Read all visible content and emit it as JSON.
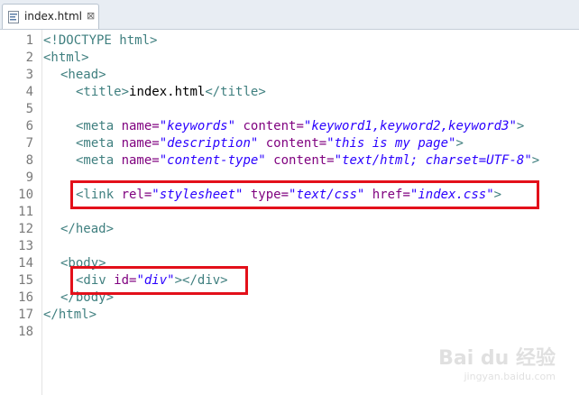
{
  "tab": {
    "title": "index.html",
    "close_glyph": "⊠",
    "icon": "html-file-icon"
  },
  "line_numbers": [
    "1",
    "2",
    "3",
    "4",
    "5",
    "6",
    "7",
    "8",
    "9",
    "10",
    "11",
    "12",
    "13",
    "14",
    "15",
    "16",
    "17",
    "18"
  ],
  "code": {
    "l1": {
      "t": "<!DOCTYPE html>"
    },
    "l2": {
      "t": "<html>"
    },
    "l3": {
      "t": "<head>"
    },
    "l4": {
      "t1": "<title>",
      "x": "index.html",
      "t2": "</title>"
    },
    "l6": {
      "t1": "<meta ",
      "a1": "name=",
      "v1": "\"keywords\"",
      "a2": " content=",
      "v2": "\"keyword1,keyword2,keyword3\"",
      "t2": ">"
    },
    "l7": {
      "t1": "<meta ",
      "a1": "name=",
      "v1": "\"description\"",
      "a2": " content=",
      "v2": "\"this is my page\"",
      "t2": ">"
    },
    "l8": {
      "t1": "<meta ",
      "a1": "name=",
      "v1": "\"content-type\"",
      "a2": " content=",
      "v2": "\"text/html; charset=UTF-8\"",
      "t2": ">"
    },
    "l10": {
      "t1": "<link ",
      "a1": "rel=",
      "v1": "\"stylesheet\"",
      "a2": " type=",
      "v2": "\"text/css\"",
      "a3": " href=",
      "v3": "\"index.css\"",
      "t2": ">"
    },
    "l12": {
      "t": "</head>"
    },
    "l14": {
      "t": "<body>"
    },
    "l15": {
      "t1": "<div ",
      "a1": "id=",
      "v1": "\"div\"",
      "t2": "></div>"
    },
    "l16": {
      "t": "</body>"
    },
    "l17": {
      "t": "</html>"
    }
  },
  "colors": {
    "tag": "#3f7f7f",
    "attr": "#7f007f",
    "value": "#2a00ff",
    "highlight": "#e3101a"
  },
  "watermark": {
    "brand": "Bai du 经验",
    "url": "jingyan.baidu.com"
  }
}
